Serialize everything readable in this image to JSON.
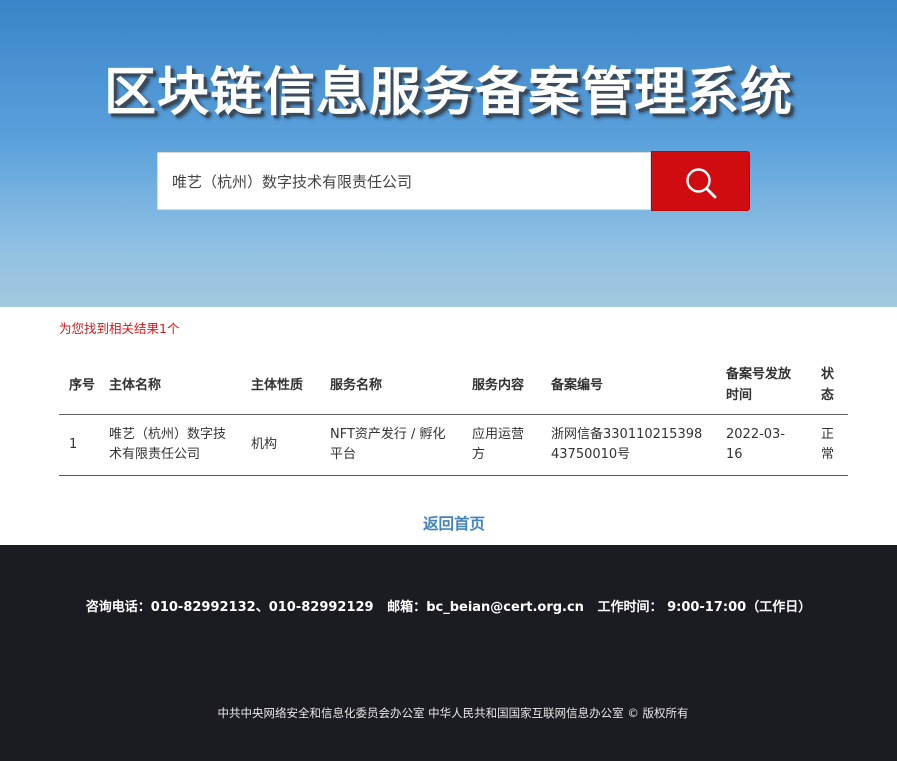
{
  "header": {
    "title": "区块链信息服务备案管理系统"
  },
  "search": {
    "value": "唯艺（杭州）数字技术有限责任公司",
    "placeholder": ""
  },
  "results": {
    "summary": "为您找到相关结果1个",
    "columns": [
      "序号",
      "主体名称",
      "主体性质",
      "服务名称",
      "服务内容",
      "备案编号",
      "备案号发放时间",
      "状态"
    ],
    "rows": [
      {
        "index": "1",
        "entity_name": "唯艺（杭州）数字技术有限责任公司",
        "entity_type": "机构",
        "service_name": "NFT资产发行 / 孵化平台",
        "service_content": "应用运营方",
        "record_number": "浙网信备33011021539843750010号",
        "issue_date": "2022-03-16",
        "status": "正常"
      }
    ]
  },
  "back_link": "返回首页",
  "footer": {
    "phone_label": "咨询电话：",
    "phone_value": "010-82992132、010-82992129",
    "email_label": "邮箱：",
    "email_value": "bc_beian@cert.org.cn",
    "hours_label": "工作时间：",
    "hours_value": "9:00-17:00（工作日）",
    "copyright": "中共中央网络安全和信息化委员会办公室   中华人民共和国国家互联网信息办公室 © 版权所有"
  },
  "colors": {
    "search_button": "#d00c10",
    "result_summary": "#d3191c",
    "link": "#4384bd",
    "footer_bg": "#1b1b22"
  },
  "icons": {
    "search_button_icon": "search-icon"
  }
}
